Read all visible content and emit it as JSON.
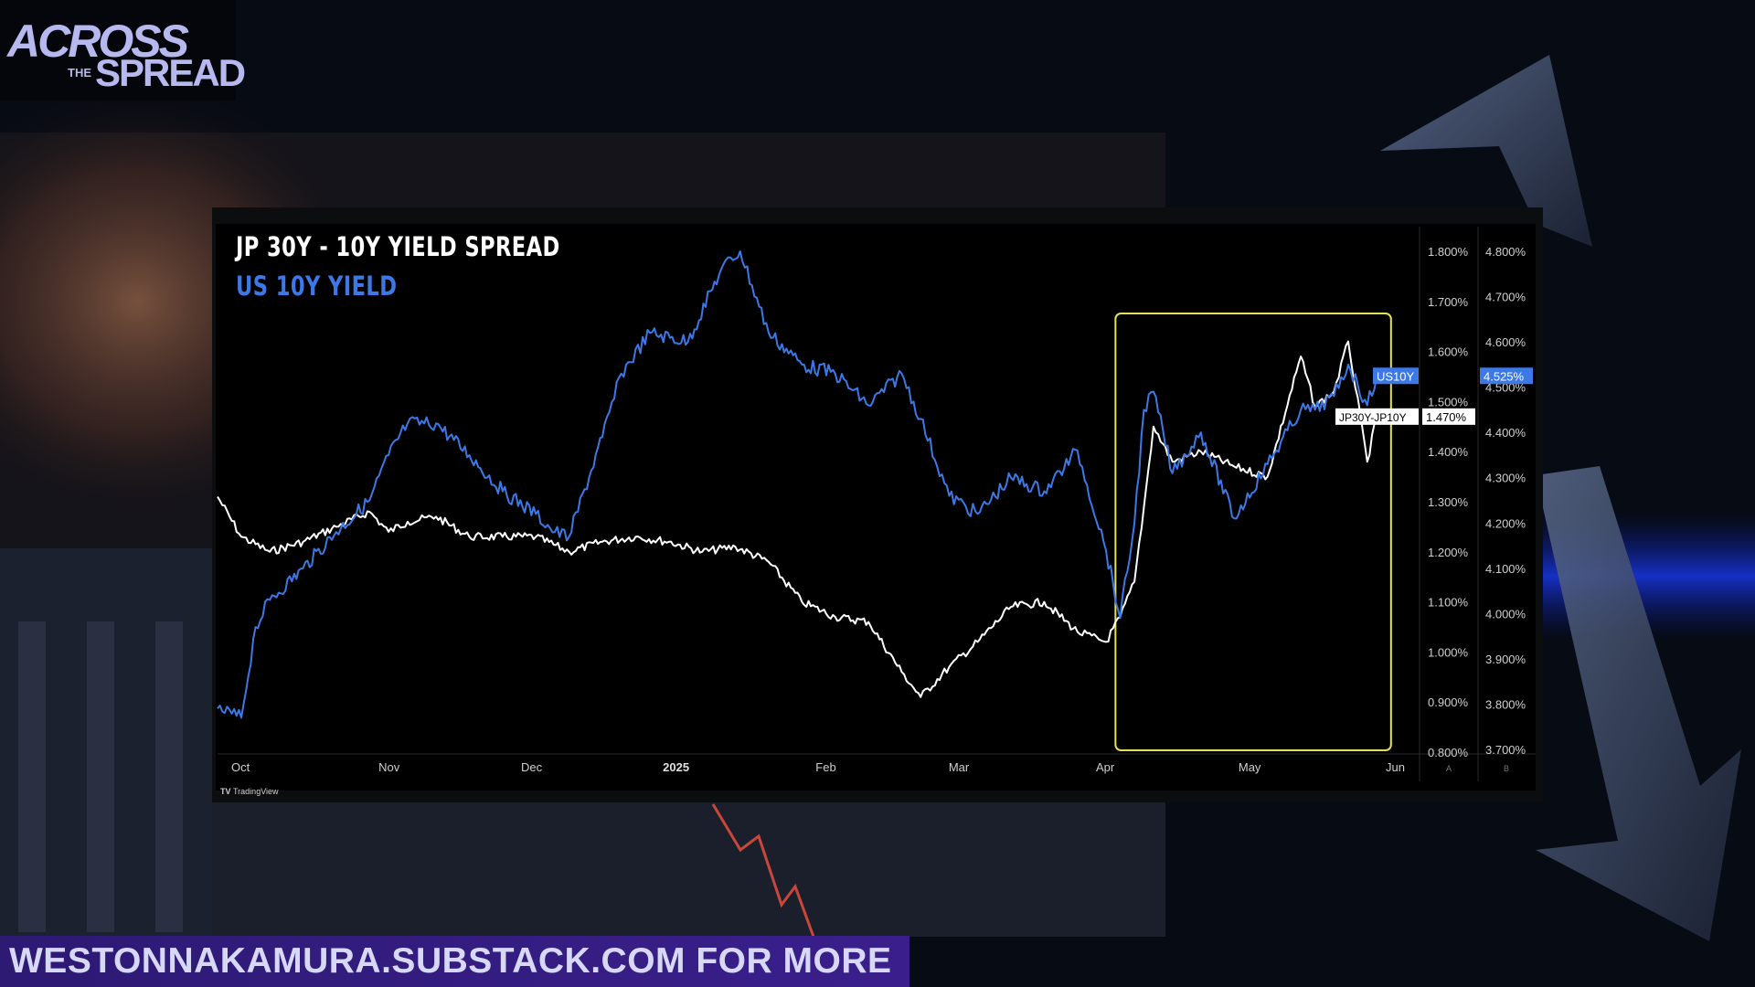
{
  "branding": {
    "logo_line1": "ACROSS",
    "logo_line2": "THE",
    "logo_line3": "SPREAD",
    "footer": "WESTONNAKAMURA.SUBSTACK.COM FOR MORE",
    "platform": "TradingView"
  },
  "chart_data": {
    "type": "line",
    "title": "JP 30Y - 10Y YIELD SPREAD",
    "subtitle": "US 10Y YIELD",
    "x_ticks": [
      "Oct",
      "Nov",
      "Dec",
      "2025",
      "Feb",
      "Mar",
      "Apr",
      "May",
      "Jun"
    ],
    "left_axis_labels": [
      "A"
    ],
    "right_axis_labels": [
      "B"
    ],
    "axis_a": {
      "ticks": [
        "1.800%",
        "1.700%",
        "1.600%",
        "1.500%",
        "1.400%",
        "1.300%",
        "1.200%",
        "1.100%",
        "1.000%",
        "0.900%",
        "0.800%"
      ],
      "ylim": [
        0.8,
        1.8
      ]
    },
    "axis_b": {
      "ticks": [
        "4.800%",
        "4.700%",
        "4.600%",
        "4.500%",
        "4.400%",
        "4.300%",
        "4.200%",
        "4.100%",
        "4.000%",
        "3.900%",
        "3.800%",
        "3.700%"
      ],
      "ylim": [
        3.7,
        4.8
      ]
    },
    "series": [
      {
        "name": "JP30Y-JP10Y",
        "axis": "A",
        "color": "#ffffff",
        "last_value": "1.470%",
        "x": [
          "2024-09-26",
          "2024-10-01",
          "2024-10-07",
          "2024-10-14",
          "2024-10-21",
          "2024-10-28",
          "2024-11-01",
          "2024-11-05",
          "2024-11-11",
          "2024-11-18",
          "2024-11-25",
          "2024-12-02",
          "2024-12-09",
          "2024-12-16",
          "2024-12-23",
          "2024-12-30",
          "2025-01-06",
          "2025-01-13",
          "2025-01-20",
          "2025-01-27",
          "2025-02-03",
          "2025-02-10",
          "2025-02-17",
          "2025-02-21",
          "2025-02-27",
          "2025-03-05",
          "2025-03-12",
          "2025-03-19",
          "2025-03-26",
          "2025-04-01",
          "2025-04-04",
          "2025-04-07",
          "2025-04-09",
          "2025-04-11",
          "2025-04-15",
          "2025-04-21",
          "2025-04-28",
          "2025-05-05",
          "2025-05-12",
          "2025-05-15",
          "2025-05-19",
          "2025-05-22",
          "2025-05-26",
          "2025-05-28"
        ],
        "values": [
          1.31,
          1.23,
          1.2,
          1.22,
          1.25,
          1.28,
          1.24,
          1.26,
          1.27,
          1.23,
          1.23,
          1.23,
          1.2,
          1.22,
          1.23,
          1.22,
          1.2,
          1.21,
          1.18,
          1.1,
          1.07,
          1.06,
          0.96,
          0.91,
          0.97,
          1.02,
          1.09,
          1.1,
          1.04,
          1.02,
          1.07,
          1.14,
          1.29,
          1.45,
          1.38,
          1.4,
          1.37,
          1.35,
          1.59,
          1.49,
          1.52,
          1.62,
          1.38,
          1.47
        ]
      },
      {
        "name": "US10Y",
        "axis": "B",
        "color": "#3d79e6",
        "last_value": "4.525%",
        "x": [
          "2024-09-26",
          "2024-10-01",
          "2024-10-04",
          "2024-10-07",
          "2024-10-14",
          "2024-10-21",
          "2024-10-28",
          "2024-11-01",
          "2024-11-05",
          "2024-11-11",
          "2024-11-18",
          "2024-11-25",
          "2024-12-02",
          "2024-12-06",
          "2024-12-09",
          "2024-12-16",
          "2024-12-20",
          "2024-12-26",
          "2025-01-03",
          "2025-01-10",
          "2025-01-14",
          "2025-01-20",
          "2025-01-27",
          "2025-02-03",
          "2025-02-10",
          "2025-02-17",
          "2025-02-21",
          "2025-02-27",
          "2025-03-05",
          "2025-03-12",
          "2025-03-19",
          "2025-03-26",
          "2025-04-01",
          "2025-04-04",
          "2025-04-07",
          "2025-04-09",
          "2025-04-11",
          "2025-04-15",
          "2025-04-21",
          "2025-04-28",
          "2025-05-05",
          "2025-05-12",
          "2025-05-15",
          "2025-05-19",
          "2025-05-22",
          "2025-05-26",
          "2025-05-28"
        ],
        "values": [
          3.79,
          3.77,
          3.97,
          4.03,
          4.1,
          4.18,
          4.25,
          4.35,
          4.42,
          4.42,
          4.35,
          4.27,
          4.22,
          4.18,
          4.17,
          4.39,
          4.53,
          4.62,
          4.6,
          4.76,
          4.8,
          4.62,
          4.55,
          4.53,
          4.46,
          4.53,
          4.43,
          4.26,
          4.22,
          4.3,
          4.27,
          4.36,
          4.14,
          3.99,
          4.2,
          4.45,
          4.49,
          4.31,
          4.4,
          4.21,
          4.33,
          4.45,
          4.45,
          4.48,
          4.55,
          4.46,
          4.525
        ]
      }
    ],
    "highlight_box": {
      "x_start": "2025-04-03",
      "x_end": "2025-05-31",
      "color": "#e6df5a"
    },
    "x_range": [
      "2024-09-26",
      "2025-06-06"
    ],
    "grid": false
  }
}
